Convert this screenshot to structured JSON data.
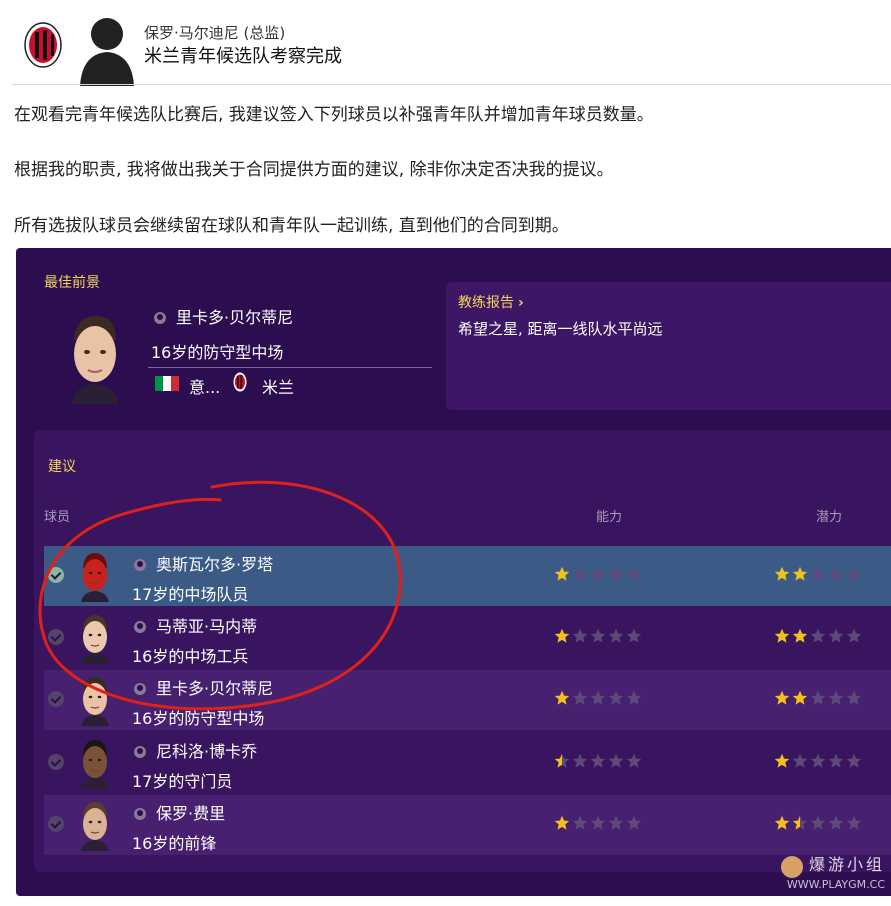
{
  "header": {
    "sender": "保罗·马尔迪尼 (总监)",
    "subject": "米兰青年候选队考察完成"
  },
  "body": {
    "p1": "在观看完青年候选队比赛后, 我建议签入下列球员以补强青年队并增加青年球员数量。",
    "p2": "根据我的职责, 我将做出我关于合同提供方面的建议, 除非你决定否决我的提议。",
    "p3": "所有选拔队球员会继续留在球队和青年队一起训练, 直到他们的合同到期。"
  },
  "best": {
    "label": "最佳前景",
    "name": "里卡多·贝尔蒂尼",
    "desc": "16岁的防守型中场",
    "nation": "意...",
    "club": "米兰"
  },
  "coach": {
    "title": "教练报告",
    "chevron": "›",
    "text": "希望之星, 距离一线队水平尚远"
  },
  "recommend": {
    "label": "建议",
    "col_player": "球员",
    "col_ability": "能力",
    "col_potential": "潜力",
    "players": [
      {
        "name": "奥斯瓦尔多·罗塔",
        "desc": "17岁的中场队员",
        "ability": 1,
        "potential": 2,
        "selected": true
      },
      {
        "name": "马蒂亚·马内蒂",
        "desc": "16岁的中场工兵",
        "ability": 1,
        "potential": 2,
        "selected": false
      },
      {
        "name": "里卡多·贝尔蒂尼",
        "desc": "16岁的防守型中场",
        "ability": 1,
        "potential": 2,
        "selected": false
      },
      {
        "name": "尼科洛·博卡乔",
        "desc": "17岁的守门员",
        "ability": 0.5,
        "potential": 1,
        "selected": false
      },
      {
        "name": "保罗·费里",
        "desc": "16岁的前锋",
        "ability": 1,
        "potential": 1.5,
        "selected": false
      }
    ]
  },
  "watermark": {
    "brand": "爆游小组",
    "url": "WWW.PLAYGM.CC"
  },
  "colors": {
    "panel": "#2c0d4f",
    "accent": "#f1d55c",
    "star_on": "#f2c21b",
    "star_off": "#5e4a7a",
    "annotation": "#e0201a"
  }
}
